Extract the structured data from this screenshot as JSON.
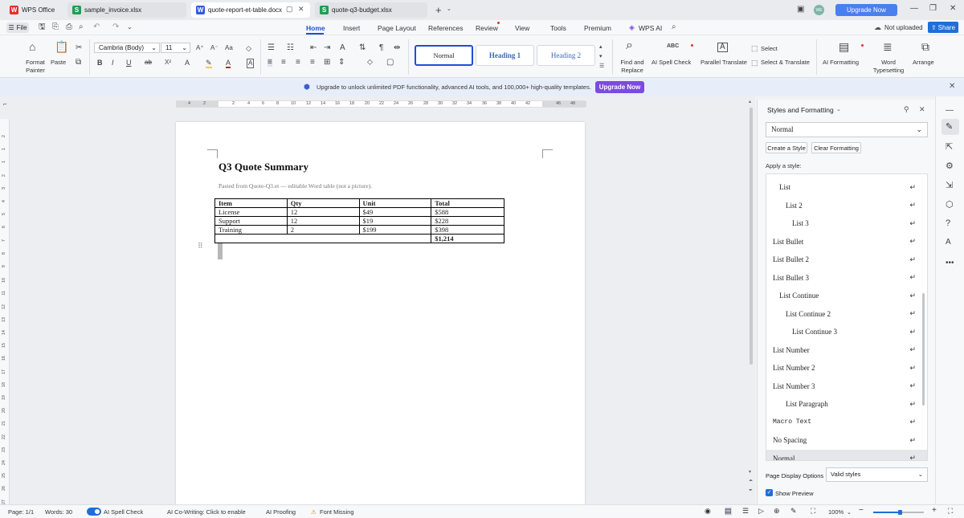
{
  "titlebar": {
    "tabs": [
      {
        "label": "WPS Office",
        "icon": "wps-logo"
      },
      {
        "label": "sample_invoice.xlsx",
        "icon": "spreadsheet-icon"
      },
      {
        "label": "quote-report-et-table.docx",
        "icon": "writer-icon",
        "active": true
      },
      {
        "label": "quote-q3-budget.xlsx",
        "icon": "spreadsheet-icon"
      }
    ],
    "avatar_initials": "WE",
    "upgrade_label": "Upgrade Now"
  },
  "menubar": {
    "file_label": "File",
    "items": [
      "Home",
      "Insert",
      "Page Layout",
      "References",
      "Review",
      "View",
      "Tools",
      "Premium",
      "WPS AI"
    ],
    "active": "Home",
    "not_uploaded": "Not uploaded",
    "share": "Share"
  },
  "ribbon": {
    "format_painter": "Format Painter",
    "paste": "Paste",
    "font_name": "Cambria (Body)",
    "font_size": "11",
    "styles": [
      "Normal",
      "Heading 1",
      "Heading 2"
    ],
    "find_replace": "Find and Replace",
    "ai_spell_check": "AI Spell Check",
    "parallel_translate": "Parallel Translate",
    "select": "Select",
    "select_translate": "Select & Translate",
    "ai_formatting": "AI Formatting",
    "word_typesetting": "Word Typesetting",
    "arrange": "Arrange"
  },
  "banner": {
    "text": "Upgrade to unlock unlimited PDF functionality, advanced AI tools, and 100,000+ high-quality templates.",
    "button": "Upgrade Now"
  },
  "ruler": {
    "h_ticks": [
      "4",
      "2",
      "2",
      "4",
      "6",
      "8",
      "10",
      "12",
      "14",
      "16",
      "18",
      "20",
      "22",
      "24",
      "26",
      "28",
      "30",
      "32",
      "34",
      "36",
      "38",
      "40",
      "42",
      "46",
      "48"
    ],
    "v_ticks": [
      "2",
      "1",
      "1",
      "2",
      "3",
      "4",
      "5",
      "6",
      "7",
      "8",
      "9",
      "10",
      "11",
      "12",
      "13",
      "14",
      "15",
      "16",
      "17",
      "18",
      "19",
      "20",
      "21",
      "22",
      "23",
      "24",
      "25",
      "26",
      "27",
      "28"
    ]
  },
  "document": {
    "title": "Q3 Quote Summary",
    "subtitle": "Pasted from Quote-Q3.et — editable Word table (not a picture).",
    "table": {
      "headers": [
        "Item",
        "Qty",
        "Unit",
        "Total"
      ],
      "rows": [
        [
          "License",
          "12",
          "$49",
          "$588"
        ],
        [
          "Support",
          "12",
          "$19",
          "$228"
        ],
        [
          "Training",
          "2",
          "$199",
          "$398"
        ]
      ],
      "total": "$1,214"
    }
  },
  "panel": {
    "title": "Styles and Formatting",
    "current_style": "Normal",
    "create_style": "Create a Style",
    "clear_formatting": "Clear Formatting",
    "apply_label": "Apply a style:",
    "styles": [
      {
        "name": "List",
        "indent": 1
      },
      {
        "name": "List 2",
        "indent": 2
      },
      {
        "name": "List 3",
        "indent": 3
      },
      {
        "name": "List Bullet",
        "indent": 0
      },
      {
        "name": "List Bullet 2",
        "indent": 0
      },
      {
        "name": "List Bullet 3",
        "indent": 0
      },
      {
        "name": "List Continue",
        "indent": 1
      },
      {
        "name": "List Continue 2",
        "indent": 2
      },
      {
        "name": "List Continue 3",
        "indent": 3
      },
      {
        "name": "List Number",
        "indent": 0
      },
      {
        "name": "List Number 2",
        "indent": 0
      },
      {
        "name": "List Number 3",
        "indent": 0
      },
      {
        "name": "List Paragraph",
        "indent": 2
      },
      {
        "name": "Macro Text",
        "indent": 0,
        "mono": true
      },
      {
        "name": "No Spacing",
        "indent": 0
      },
      {
        "name": "Normal",
        "indent": 0,
        "selected": true
      }
    ],
    "display_options_label": "Page Display Options",
    "display_options_value": "Valid styles",
    "show_preview": "Show Preview"
  },
  "statusbar": {
    "page": "Page: 1/1",
    "words": "Words: 30",
    "ai_spell_check": "AI Spell Check",
    "ai_cowriting": "AI Co-Writing: Click to enable",
    "ai_proofing": "AI Proofing",
    "font_missing": "Font Missing",
    "zoom": "100%"
  },
  "colors": {
    "accent": "#1e4fd8",
    "upgrade": "#4a7ff0",
    "banner_button": "#7b4be0",
    "spreadsheet": "#1f9d55",
    "writer": "#2f5cd6",
    "wps": "#e0312b"
  }
}
